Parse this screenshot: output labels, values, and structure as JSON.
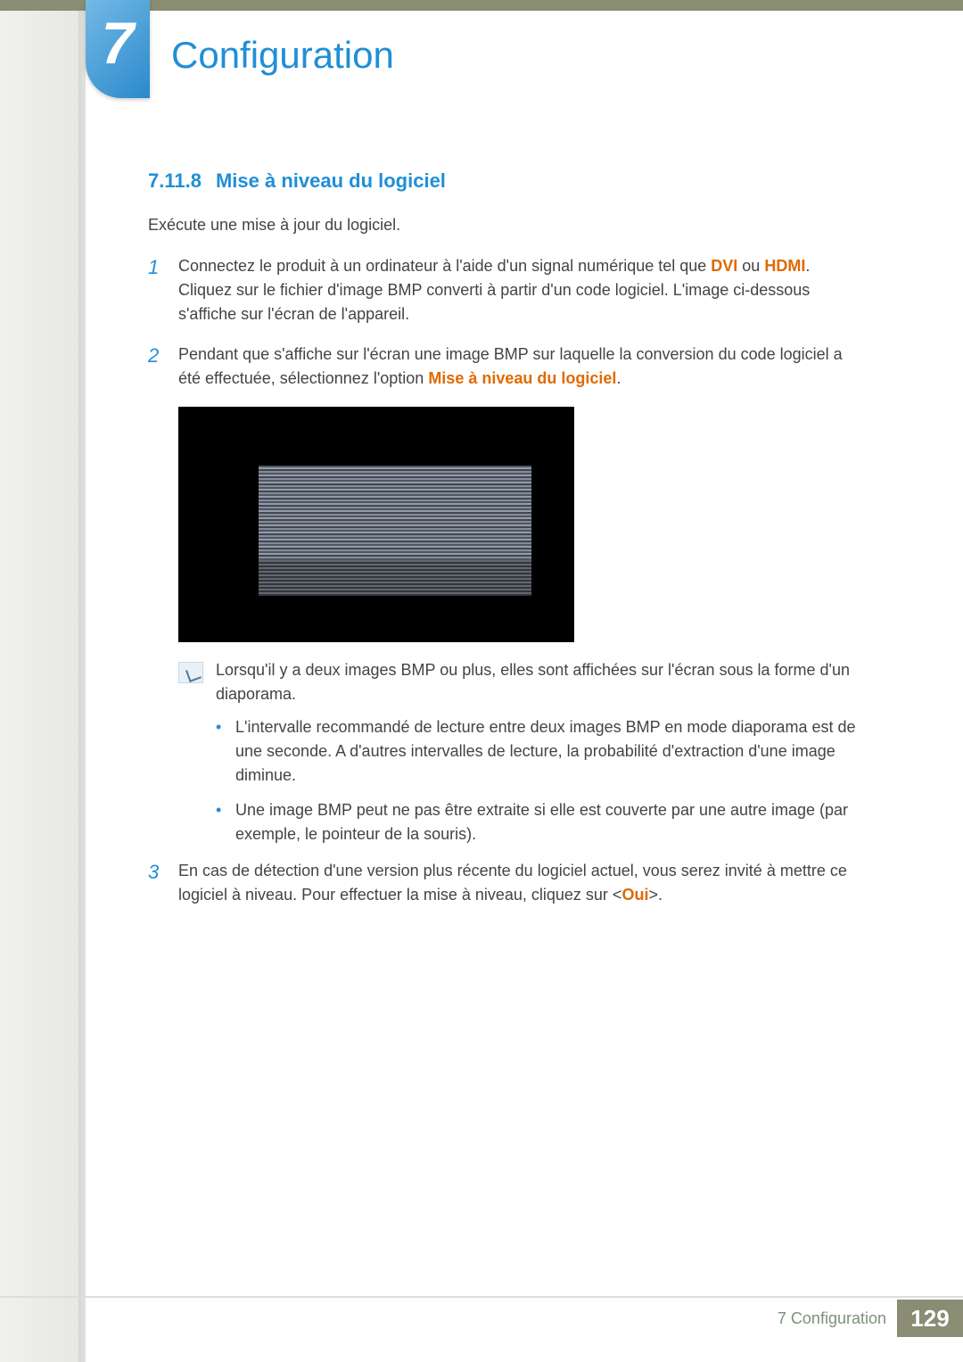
{
  "chapter": {
    "number": "7",
    "title": "Configuration"
  },
  "section": {
    "number": "7.11.8",
    "title": "Mise à niveau du logiciel"
  },
  "intro": "Exécute une mise à jour du logiciel.",
  "steps": {
    "s1": {
      "num": "1",
      "pre": "Connectez le produit à un ordinateur à l'aide d'un signal numérique tel que ",
      "dvi": "DVI",
      "mid": " ou ",
      "hdmi": "HDMI",
      "post": ". Cliquez sur le fichier d'image BMP converti à partir d'un code logiciel. L'image ci-dessous s'affiche sur l'écran de l'appareil."
    },
    "s2": {
      "num": "2",
      "pre": "Pendant que s'affiche sur l'écran une image BMP sur laquelle la conversion du code logiciel a été effectuée, sélectionnez l'option ",
      "opt": "Mise à niveau du logiciel",
      "post": "."
    },
    "s3": {
      "num": "3",
      "pre": "En cas de détection d'une version plus récente du logiciel actuel, vous serez invité à mettre ce logiciel à niveau. Pour effectuer la mise à niveau, cliquez sur <",
      "oui": "Oui",
      "post": ">."
    }
  },
  "note": "Lorsqu'il y a deux images BMP ou plus, elles sont affichées sur l'écran sous la forme d'un diaporama.",
  "bullets": {
    "b1": "L'intervalle recommandé de lecture entre deux images BMP en mode diaporama est de une seconde. A d'autres intervalles de lecture, la probabilité d'extraction d'une image diminue.",
    "b2": "Une image BMP peut ne pas être extraite si elle est couverte par une autre image (par exemple, le pointeur de la souris)."
  },
  "footer": {
    "label": "7 Configuration",
    "page": "129"
  }
}
